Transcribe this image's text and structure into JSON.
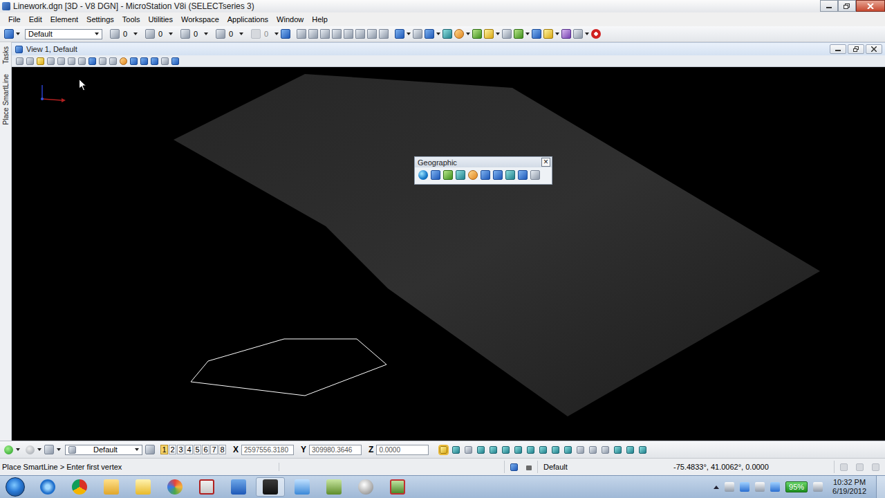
{
  "window": {
    "title": "Linework.dgn [3D - V8 DGN] - MicroStation V8i (SELECTseries 3)"
  },
  "menu": [
    "File",
    "Edit",
    "Element",
    "Settings",
    "Tools",
    "Utilities",
    "Workspace",
    "Applications",
    "Window",
    "Help"
  ],
  "toolbar": {
    "level": "Default",
    "counters": [
      {
        "value": "0",
        "disabled": false
      },
      {
        "value": "0",
        "disabled": false
      },
      {
        "value": "0",
        "disabled": false
      },
      {
        "value": "0",
        "disabled": false
      },
      {
        "value": "0",
        "disabled": true
      }
    ]
  },
  "side_tabs": [
    "Tasks",
    "Place SmartLine"
  ],
  "view": {
    "title": "View 1, Default"
  },
  "geographic_toolbar": {
    "title": "Geographic",
    "close": "×"
  },
  "attributes": {
    "level": "Default",
    "views": [
      {
        "label": "1",
        "selected": true
      },
      {
        "label": "2",
        "selected": false
      },
      {
        "label": "3",
        "selected": false
      },
      {
        "label": "4",
        "selected": false
      },
      {
        "label": "5",
        "selected": false
      },
      {
        "label": "6",
        "selected": false
      },
      {
        "label": "7",
        "selected": false
      },
      {
        "label": "8",
        "selected": false
      }
    ],
    "fields": [
      {
        "label": "X",
        "value": "2597556.3180"
      },
      {
        "label": "Y",
        "value": "309980.3646"
      },
      {
        "label": "Z",
        "value": "0.0000"
      }
    ]
  },
  "status_bar": {
    "prompt": "Place SmartLine > Enter first vertex",
    "level": "Default",
    "coordinates": "-75.4833°, 41.0062°, 0.0000"
  },
  "taskbar": {
    "battery": "95%",
    "time": "10:32 PM",
    "date": "6/19/2012"
  }
}
